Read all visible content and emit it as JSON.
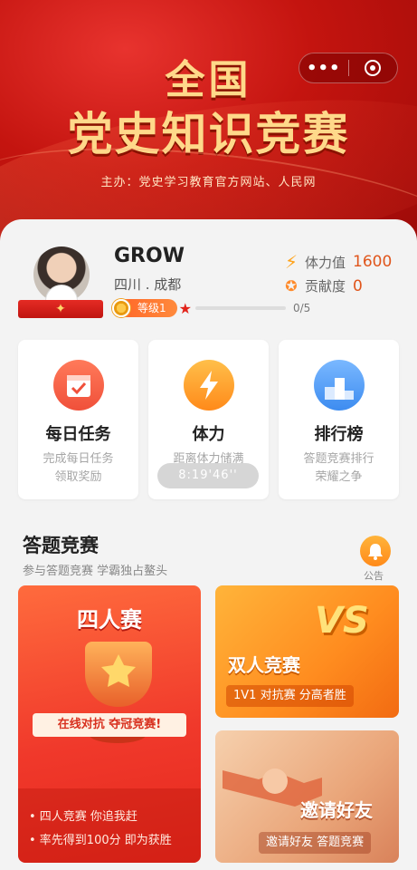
{
  "banner": {
    "title_line1": "全国",
    "title_line2": "党史知识竞赛",
    "organizer": "主办：党史学习教育官方网站、人民网"
  },
  "capsule": {
    "more_icon": "more-dots-icon",
    "close_icon": "close-circle-icon"
  },
  "profile": {
    "name": "GROW",
    "location": "四川 . 成都",
    "level_label": "等级1",
    "progress": "0/5",
    "progress_fraction": 0,
    "stamina_label": "体力值",
    "stamina_value": "1600",
    "contribution_label": "贡献度",
    "contribution_value": "0"
  },
  "cards": [
    {
      "title": "每日任务",
      "desc1": "完成每日任务",
      "desc2": "领取奖励",
      "icon": "calendar-check-icon",
      "color": "#f0503a"
    },
    {
      "title": "体力",
      "desc1": "距离体力储满",
      "timer": "8:19'46''",
      "icon": "lightning-icon",
      "color": "#ff9a2a"
    },
    {
      "title": "排行榜",
      "desc1": "答题竞赛排行",
      "desc2": "荣耀之争",
      "icon": "podium-icon",
      "color": "#3d8cf0"
    }
  ],
  "section": {
    "title": "答题竞赛",
    "subtitle": "参与答题竞赛 学霸独占鳌头",
    "notice_label": "公告"
  },
  "four": {
    "title": "四人赛",
    "banner": "在线对抗 夺冠竞赛!",
    "rule1": "• 四人竞赛 你追我赶",
    "rule2": "• 率先得到100分 即为获胜"
  },
  "duo": {
    "vs": "VS",
    "title": "双人竞赛",
    "subtitle": "1V1 对抗赛 分高者胜"
  },
  "invite": {
    "title": "邀请好友",
    "subtitle": "邀请好友 答题竞赛"
  }
}
